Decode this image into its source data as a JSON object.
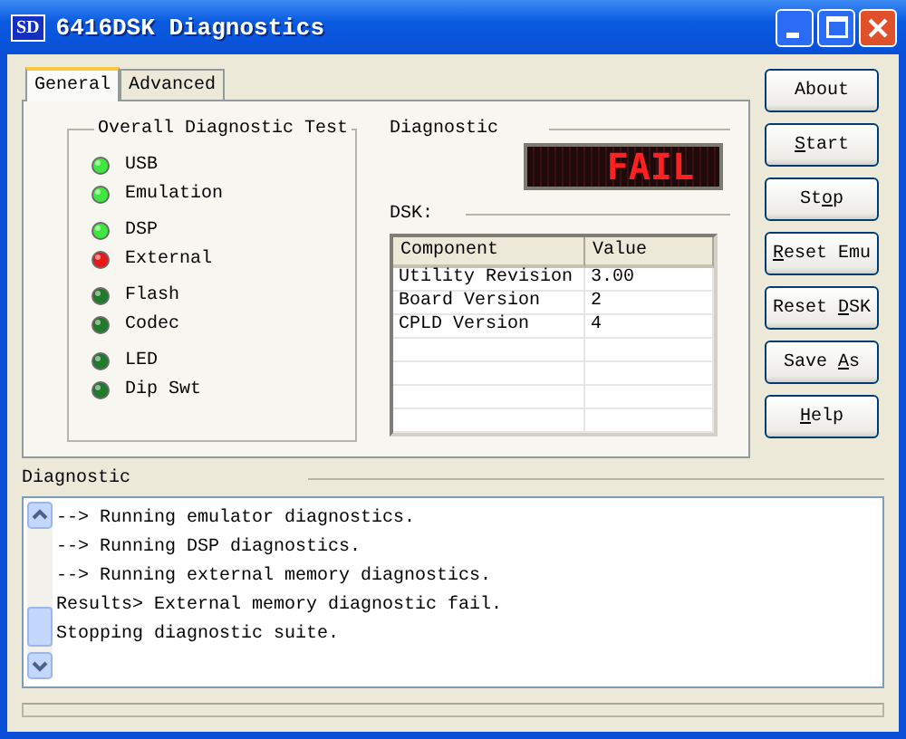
{
  "window": {
    "title": "6416DSK Diagnostics",
    "logo": "SD"
  },
  "tabs": [
    {
      "label": "General",
      "selected": true
    },
    {
      "label": "Advanced",
      "selected": false
    }
  ],
  "overall_test": {
    "title": "Overall Diagnostic Test",
    "items": [
      {
        "label": "USB",
        "color": "#3ee83e"
      },
      {
        "label": "Emulation",
        "color": "#3ee83e"
      },
      {
        "label": "DSP",
        "color": "#3ee83e"
      },
      {
        "label": "External",
        "color": "#e81818"
      },
      {
        "label": "Flash",
        "color": "#1f7a2a"
      },
      {
        "label": "Codec",
        "color": "#1f7a2a"
      },
      {
        "label": "LED",
        "color": "#1f7a2a"
      },
      {
        "label": "Dip Swt",
        "color": "#1f7a2a"
      }
    ]
  },
  "diagnostic": {
    "label": "Diagnostic",
    "display": "FAIL"
  },
  "dsk": {
    "label": "DSK:",
    "columns": [
      "Component",
      "Value"
    ],
    "rows": [
      [
        "Utility Revision",
        "3.00"
      ],
      [
        "Board Version",
        "2"
      ],
      [
        "CPLD Version",
        "4"
      ]
    ]
  },
  "buttons": [
    {
      "pre": "About"
    },
    {
      "key": "S",
      "post": "tart"
    },
    {
      "pre": "St",
      "key": "o",
      "post": "p"
    },
    {
      "key": "R",
      "post": "eset Emu"
    },
    {
      "pre": "Reset ",
      "key": "D",
      "post": "SK"
    },
    {
      "pre": "Save ",
      "key": "A",
      "post": "s"
    },
    {
      "key": "H",
      "post": "elp"
    }
  ],
  "log": {
    "label": "Diagnostic",
    "lines": [
      "--> Running emulator diagnostics.",
      "--> Running DSP diagnostics.",
      "--> Running external memory diagnostics.",
      "Results> External memory diagnostic fail.",
      "Stopping diagnostic suite."
    ]
  }
}
